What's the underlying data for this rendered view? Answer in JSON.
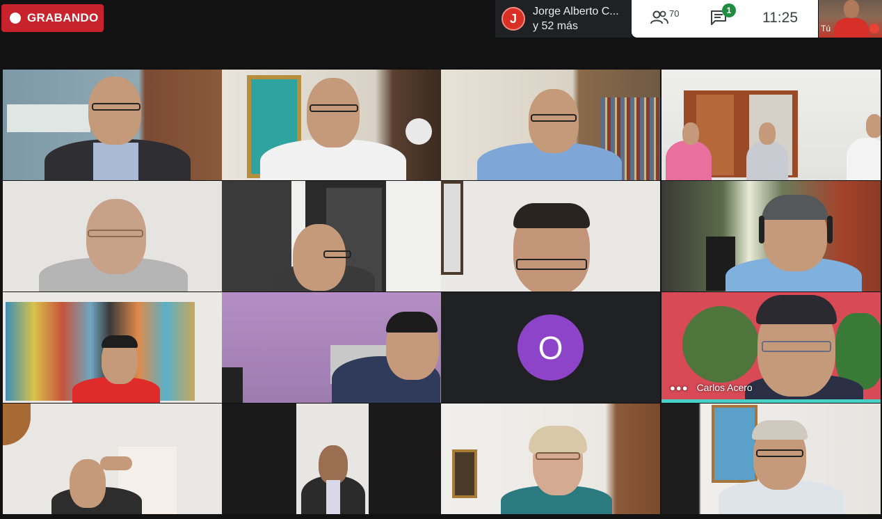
{
  "recording": {
    "label": "GRABANDO",
    "color": "#c8232c"
  },
  "presenter": {
    "initial": "J",
    "name": "Jorge Alberto C...",
    "more": "y 52 más"
  },
  "toolbar": {
    "people_icon": "people-icon",
    "people_count": "70",
    "chat_icon": "chat-icon",
    "chat_badge": "1",
    "time": "11:25"
  },
  "self_view": {
    "label": "Tú"
  },
  "tiles": [
    {
      "id": "tile-1"
    },
    {
      "id": "tile-2"
    },
    {
      "id": "tile-3"
    },
    {
      "id": "tile-4"
    },
    {
      "id": "tile-5"
    },
    {
      "id": "tile-6"
    },
    {
      "id": "tile-7"
    },
    {
      "id": "tile-8"
    },
    {
      "id": "tile-9"
    },
    {
      "id": "tile-10"
    },
    {
      "id": "tile-11",
      "avatar": "O",
      "avatar_color": "#8e44c8"
    },
    {
      "id": "tile-12",
      "name": "Carlos Acero",
      "speaking": true
    },
    {
      "id": "tile-13"
    },
    {
      "id": "tile-14"
    },
    {
      "id": "tile-15"
    },
    {
      "id": "tile-16"
    }
  ],
  "colors": {
    "active_speaker": "#46d0c6",
    "background": "#121212"
  }
}
